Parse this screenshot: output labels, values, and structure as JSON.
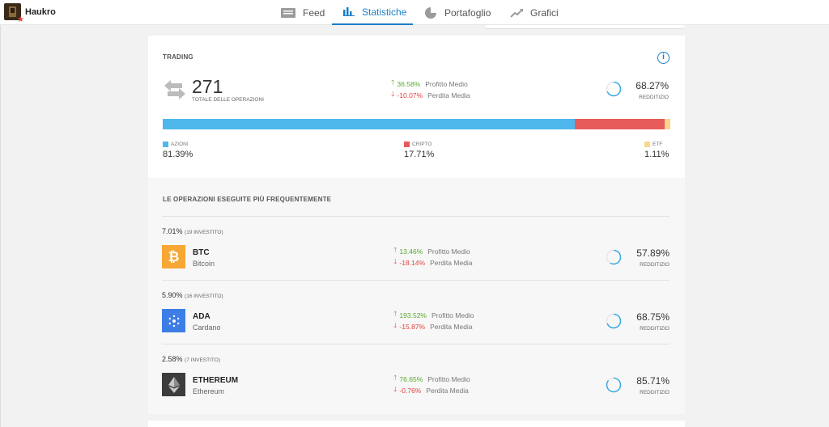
{
  "user": {
    "name": "Haukro"
  },
  "nav": {
    "tabs": [
      {
        "label": "Feed",
        "icon": "feed-icon"
      },
      {
        "label": "Statistiche",
        "icon": "stats-icon",
        "active": true
      },
      {
        "label": "Portafoglio",
        "icon": "pie-icon"
      },
      {
        "label": "Grafici",
        "icon": "chart-icon"
      }
    ]
  },
  "trading": {
    "title": "TRADING",
    "total_trades": "271",
    "total_trades_label": "TOTALE DELLE OPERAZIONI",
    "avg_profit_value": "36.58%",
    "avg_profit_label": "Profitto Medio",
    "avg_loss_value": "-10.07%",
    "avg_loss_label": "Perdita Media",
    "profitability_value": "68.27%",
    "profitability_label": "REDDITIZIO",
    "profitability_fraction": 0.6827,
    "allocation": [
      {
        "label": "AZIONI",
        "value": "81.39%",
        "fraction": 0.8139,
        "color": "#4eb8ec"
      },
      {
        "label": "CRIPTO",
        "value": "17.71%",
        "fraction": 0.1771,
        "color": "#e85b5b"
      },
      {
        "label": "ETF",
        "value": "1.11%",
        "fraction": 0.0111,
        "color": "#f9d78a"
      }
    ]
  },
  "frequent": {
    "title": "LE OPERAZIONI ESEGUITE PIÙ FREQUENTEMENTE",
    "profit_label": "Profitto Medio",
    "loss_label": "Perdita Media",
    "profitability_label": "REDDITIZIO",
    "items": [
      {
        "pct": "7.01%",
        "invested": "(19 INVESTITO)",
        "symbol": "BTC",
        "name": "Bitcoin",
        "profit": "13.46%",
        "loss": "-18.14%",
        "profitability": "57.89%",
        "fraction": 0.5789,
        "icon": "bitcoin-icon",
        "color": "#f7a733"
      },
      {
        "pct": "5.90%",
        "invested": "(16 INVESTITO)",
        "symbol": "ADA",
        "name": "Cardano",
        "profit": "193.52%",
        "loss": "-15.87%",
        "profitability": "68.75%",
        "fraction": 0.6875,
        "icon": "cardano-icon",
        "color": "#3d7ee6"
      },
      {
        "pct": "2.58%",
        "invested": "(7 INVESTITO)",
        "symbol": "ETHEREUM",
        "name": "Ethereum",
        "profit": "76.65%",
        "loss": "-0.76%",
        "profitability": "85.71%",
        "fraction": 0.8571,
        "icon": "ethereum-icon",
        "color": "#3c3c3d"
      }
    ]
  }
}
